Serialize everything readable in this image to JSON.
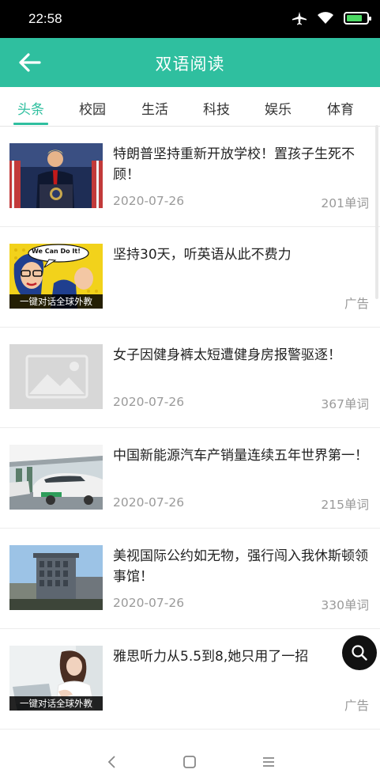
{
  "status_bar": {
    "time": "22:58",
    "icons": [
      "airplane-icon",
      "wifi-icon",
      "battery-charging-icon"
    ],
    "battery_level": 0.8
  },
  "app_bar": {
    "title": "双语阅读",
    "back_icon": "arrow-left-icon"
  },
  "tabs": [
    {
      "label": "头条",
      "active": true
    },
    {
      "label": "校园",
      "active": false
    },
    {
      "label": "生活",
      "active": false
    },
    {
      "label": "科技",
      "active": false
    },
    {
      "label": "娱乐",
      "active": false
    },
    {
      "label": "体育",
      "active": false
    }
  ],
  "articles": [
    {
      "title": "特朗普坚持重新开放学校！置孩子生死不顾！",
      "date": "2020-07-26",
      "meta": "201单词",
      "thumb": "press-conference-photo"
    },
    {
      "title": "坚持30天，听英语从此不费力",
      "date": "",
      "meta": "广告",
      "thumb": "pop-art-ad",
      "thumb_caption": "一键对话全球外教",
      "thumb_text": "We Can Do It!"
    },
    {
      "title": "女子因健身裤太短遭健身房报警驱逐！",
      "date": "2020-07-26",
      "meta": "367单词",
      "thumb": "image-placeholder"
    },
    {
      "title": "中国新能源汽车产销量连续五年世界第一！",
      "date": "2020-07-26",
      "meta": "215单词",
      "thumb": "electric-cars-photo"
    },
    {
      "title": "美视国际公约如无物，强行闯入我休斯顿领事馆！",
      "date": "2020-07-26",
      "meta": "330单词",
      "thumb": "consulate-building-photo"
    },
    {
      "title": "雅思听力从5.5到8,她只用了一招",
      "date": "",
      "meta": "广告",
      "thumb": "woman-laptop-ad",
      "thumb_caption": "一键对话全球外教"
    }
  ],
  "fab": {
    "icon": "search-icon"
  },
  "nav_bar": {
    "icons": [
      "nav-back-icon",
      "nav-home-icon",
      "nav-menu-icon"
    ]
  },
  "colors": {
    "accent": "#2fbf9f",
    "status_bar": "#000000",
    "text_secondary": "#9a9a9a"
  }
}
